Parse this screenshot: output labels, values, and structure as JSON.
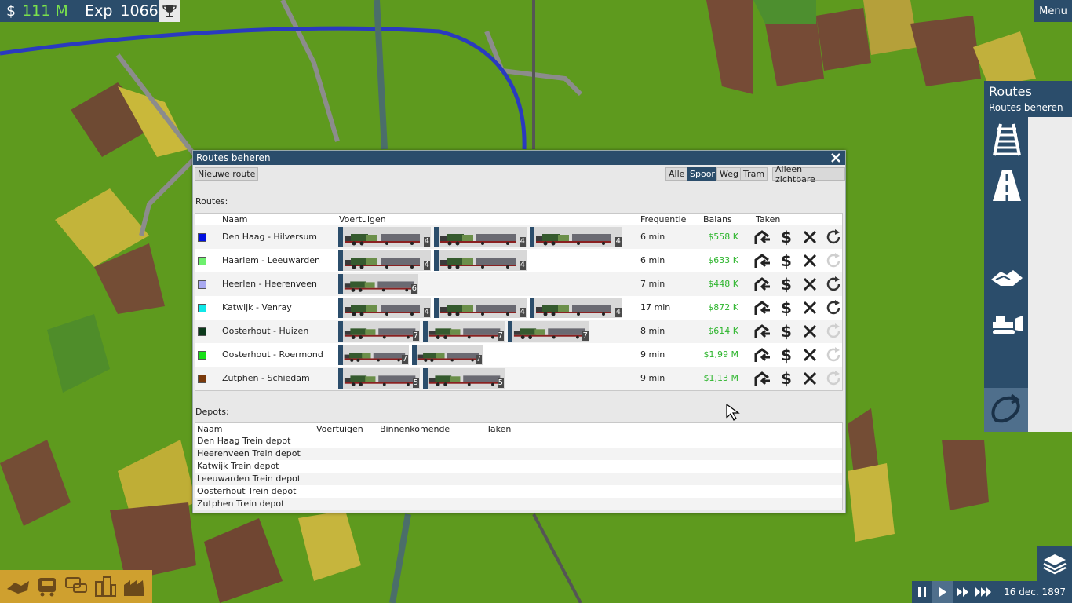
{
  "hud": {
    "dollar_sign": "$",
    "money": "111 M",
    "exp_label": "Exp",
    "exp_value": "1066"
  },
  "menu": {
    "label": "Menu"
  },
  "side_panel": {
    "title": "Routes",
    "subtitle": "Routes beheren",
    "tools": [
      "rail-icon",
      "road-icon",
      "terrain-icon",
      "bulldozer-icon",
      "routes-loop-icon"
    ]
  },
  "dialog": {
    "title": "Routes beheren",
    "new_route": "Nieuwe route",
    "filters": [
      {
        "label": "Alle",
        "selected": false
      },
      {
        "label": "Spoor",
        "selected": true
      },
      {
        "label": "Weg",
        "selected": false
      },
      {
        "label": "Tram",
        "selected": false
      }
    ],
    "only_visible": "Alleen zichtbare",
    "routes_label": "Routes:",
    "routes_columns": [
      "Naam",
      "Voertuigen",
      "Frequentie",
      "Balans",
      "Taken"
    ],
    "routes": [
      {
        "color": "#0010e0",
        "name": "Den Haag - Hilversum",
        "vehicles": [
          "4",
          "4",
          "4"
        ],
        "frequency": "6 min",
        "balance": "$558 K",
        "reload_active": true
      },
      {
        "color": "#6ef06e",
        "name": "Haarlem - Leeuwarden",
        "vehicles": [
          "4",
          "4"
        ],
        "frequency": "6 min",
        "balance": "$633 K",
        "reload_active": false
      },
      {
        "color": "#a9a9f0",
        "name": "Heerlen - Heerenveen",
        "vehicles": [
          "6"
        ],
        "frequency": "7 min",
        "balance": "$448 K",
        "reload_active": true
      },
      {
        "color": "#10e8e8",
        "name": "Katwijk - Venray",
        "vehicles": [
          "4",
          "4",
          "4"
        ],
        "frequency": "17 min",
        "balance": "$872 K",
        "reload_active": true
      },
      {
        "color": "#0c3a1c",
        "name": "Oosterhout - Huizen",
        "vehicles": [
          "7",
          "7",
          "7"
        ],
        "frequency": "8 min",
        "balance": "$614 K",
        "reload_active": false
      },
      {
        "color": "#18e018",
        "name": "Oosterhout - Roermond",
        "vehicles": [
          "7",
          "7"
        ],
        "frequency": "9 min",
        "balance": "$1,99 M",
        "reload_active": false
      },
      {
        "color": "#7a3a0c",
        "name": "Zutphen - Schiedam",
        "vehicles": [
          "5",
          "5"
        ],
        "frequency": "9 min",
        "balance": "$1,13 M",
        "reload_active": false
      }
    ],
    "depots_label": "Depots:",
    "depots_columns": [
      "Naam",
      "Voertuigen",
      "Binnenkomende",
      "Taken"
    ],
    "depots": [
      "Den Haag Trein depot",
      "Heerenveen Trein depot",
      "Katwijk Trein depot",
      "Leeuwarden Trein depot",
      "Oosterhout Trein depot",
      "Zutphen Trein depot"
    ]
  },
  "timebar": {
    "date": "16 dec. 1897"
  },
  "colors": {
    "panel": "#2b4d6b",
    "balance": "#2db52d",
    "toolbar_gold": "#cfa02f"
  }
}
